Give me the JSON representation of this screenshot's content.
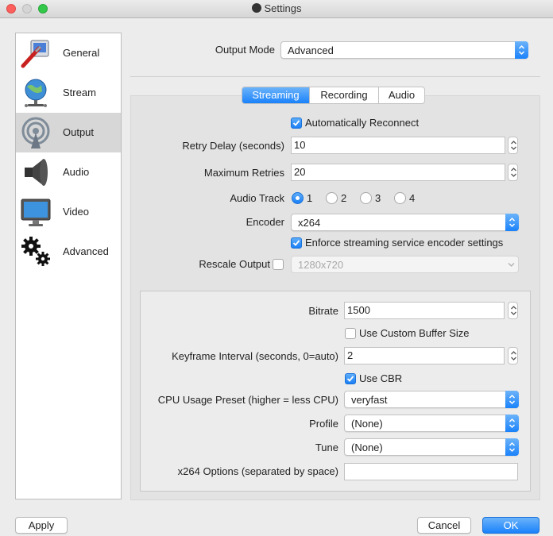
{
  "window": {
    "title": "Settings"
  },
  "sidebar": {
    "items": [
      {
        "label": "General",
        "icon": "general-settings-icon"
      },
      {
        "label": "Stream",
        "icon": "stream-globe-icon"
      },
      {
        "label": "Output",
        "icon": "output-broadcast-icon",
        "selected": true
      },
      {
        "label": "Audio",
        "icon": "speaker-icon"
      },
      {
        "label": "Video",
        "icon": "monitor-icon"
      },
      {
        "label": "Advanced",
        "icon": "gears-icon"
      }
    ]
  },
  "output_mode": {
    "label": "Output Mode",
    "value": "Advanced"
  },
  "tabs": [
    {
      "label": "Streaming",
      "active": true
    },
    {
      "label": "Recording",
      "active": false
    },
    {
      "label": "Audio",
      "active": false
    }
  ],
  "streaming": {
    "auto_reconnect": {
      "label": "Automatically Reconnect",
      "checked": true
    },
    "retry_delay": {
      "label": "Retry Delay (seconds)",
      "value": "10"
    },
    "max_retries": {
      "label": "Maximum Retries",
      "value": "20"
    },
    "audio_track": {
      "label": "Audio Track",
      "options": [
        "1",
        "2",
        "3",
        "4"
      ],
      "selected": "1"
    },
    "encoder": {
      "label": "Encoder",
      "value": "x264"
    },
    "enforce": {
      "label": "Enforce streaming service encoder settings",
      "checked": true
    },
    "rescale": {
      "label": "Rescale Output",
      "checked": false,
      "value": "1280x720"
    }
  },
  "encoder_settings": {
    "bitrate": {
      "label": "Bitrate",
      "value": "1500"
    },
    "custom_buffer": {
      "label": "Use Custom Buffer Size",
      "checked": false
    },
    "keyframe": {
      "label": "Keyframe Interval (seconds, 0=auto)",
      "value": "2"
    },
    "use_cbr": {
      "label": "Use CBR",
      "checked": true
    },
    "cpu_preset": {
      "label": "CPU Usage Preset (higher = less CPU)",
      "value": "veryfast"
    },
    "profile": {
      "label": "Profile",
      "value": "(None)"
    },
    "tune": {
      "label": "Tune",
      "value": "(None)"
    },
    "x264_options": {
      "label": "x264 Options (separated by space)",
      "value": ""
    }
  },
  "buttons": {
    "apply": "Apply",
    "cancel": "Cancel",
    "ok": "OK"
  },
  "colors": {
    "accent": "#1a82fb",
    "window_bg": "#ececec",
    "panel_bg": "#e3e3e3",
    "selected_sidebar": "#d7d7d7"
  }
}
